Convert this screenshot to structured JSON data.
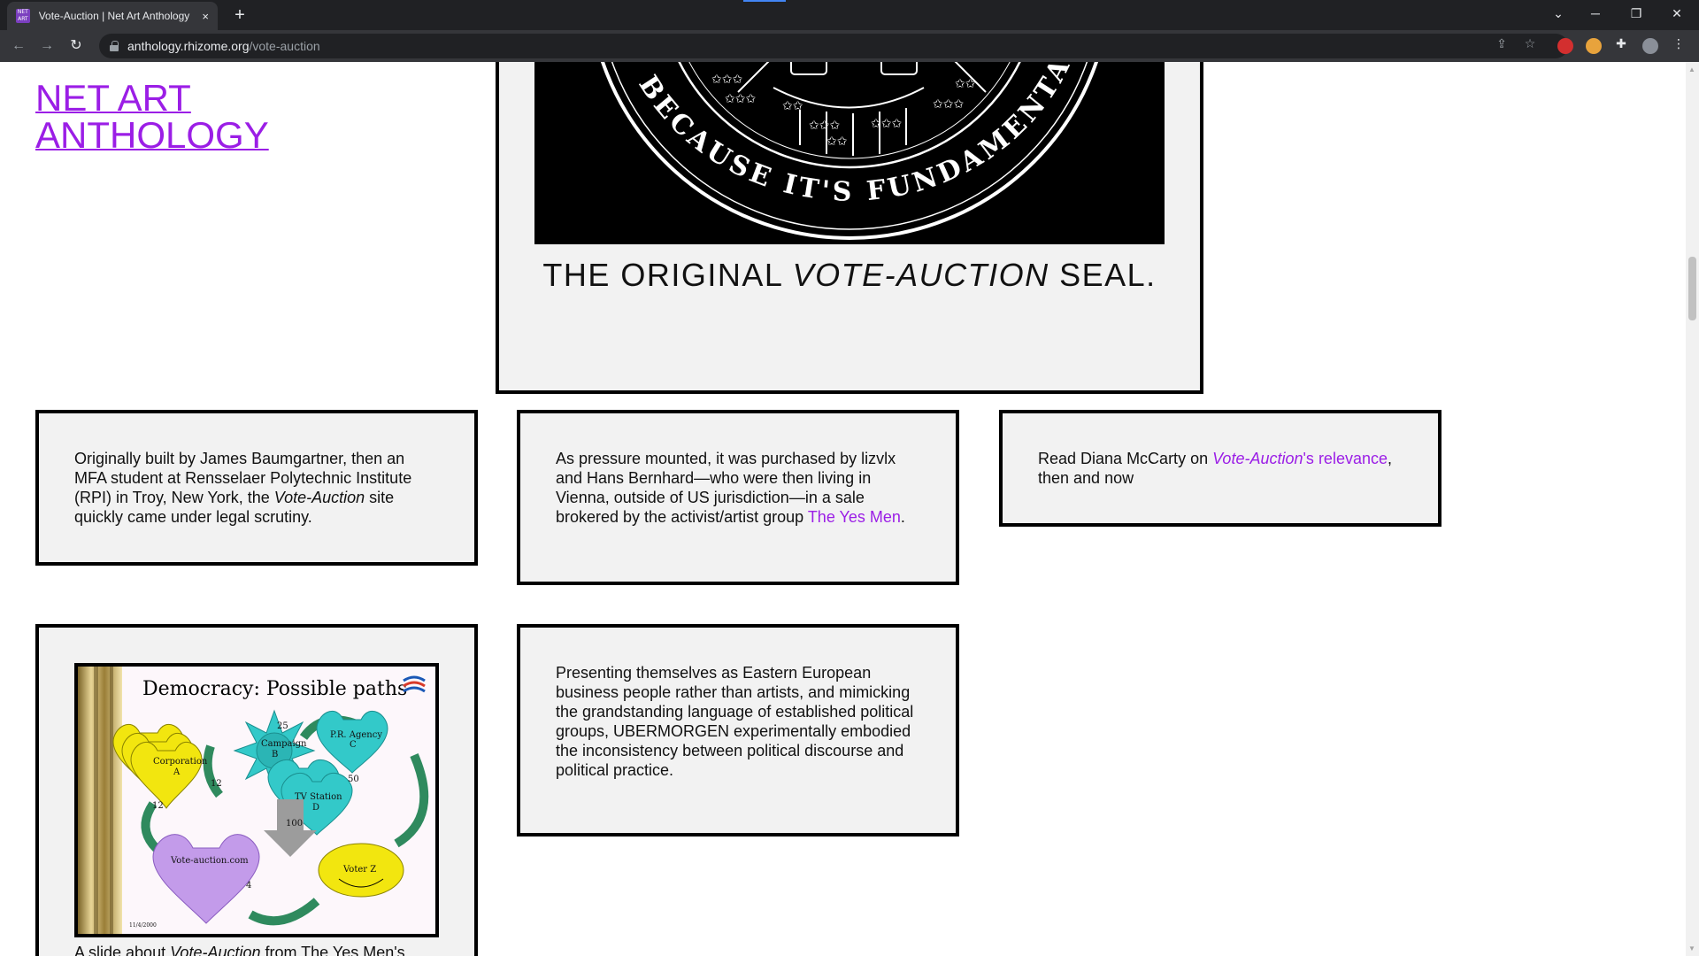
{
  "browser": {
    "tab_title": "Vote-Auction | Net Art Anthology",
    "tab_close": "×",
    "new_tab": "+",
    "url_host": "anthology.rhizome.org",
    "url_path": "/vote-auction",
    "favicon_text": "NET ART"
  },
  "site": {
    "title_line1": "NET ART",
    "title_line2": "ANTHOLOGY",
    "link_color": "#9b1ee6"
  },
  "seal": {
    "caption_before": "THE ORIGINAL ",
    "caption_italic": "VOTE-AUCTION",
    "caption_after": " SEAL.",
    "ring_text": "BECAUSE IT'S FUNDAMENTAL"
  },
  "cards": {
    "c1": {
      "text_a": "Originally built by James Baumgartner, then an MFA student at Rensselaer Polytechnic Institute (RPI) in Troy, New York, the ",
      "text_italic": "Vote-Auction",
      "text_b": " site quickly came under legal scrutiny."
    },
    "c2": {
      "text_a": "As pressure mounted, it was purchased by lizvlx and Hans Bernhard—who were then living in Vienna, outside of US jurisdiction—in a sale brokered by the activist/artist group ",
      "link": "The Yes Men",
      "text_b": "."
    },
    "c3": {
      "text_a": "Read Diana McCarty on ",
      "link_italic": "Vote-Auction",
      "link_rest": "'s relevance",
      "text_b": ", then and now"
    },
    "c4": {
      "slide": {
        "title": "Democracy: Possible paths",
        "campaign": "Campaign",
        "campaign_b": "B",
        "pr_agency": "P.R. Agency",
        "pr_c": "C",
        "corporation": "Corporation",
        "corp_a": "A",
        "tv_station": "TV Station",
        "tv_d": "D",
        "vote_auction": "Vote-auction.com",
        "voter": "Voter Z",
        "n25": "25",
        "n12a": "12",
        "n12b": "12",
        "n50": "50",
        "n100": "100",
        "n4": "4",
        "date": "11/4/2000"
      },
      "caption_a": "A slide about ",
      "caption_italic": "Vote-Auction",
      "caption_b": " from The Yes Men's"
    },
    "c5": {
      "text": "Presenting themselves as Eastern European business people rather than artists, and mimicking the grandstanding language of established political groups, UBERMORGEN experimentally embodied the inconsistency between political discourse and political practice."
    }
  }
}
